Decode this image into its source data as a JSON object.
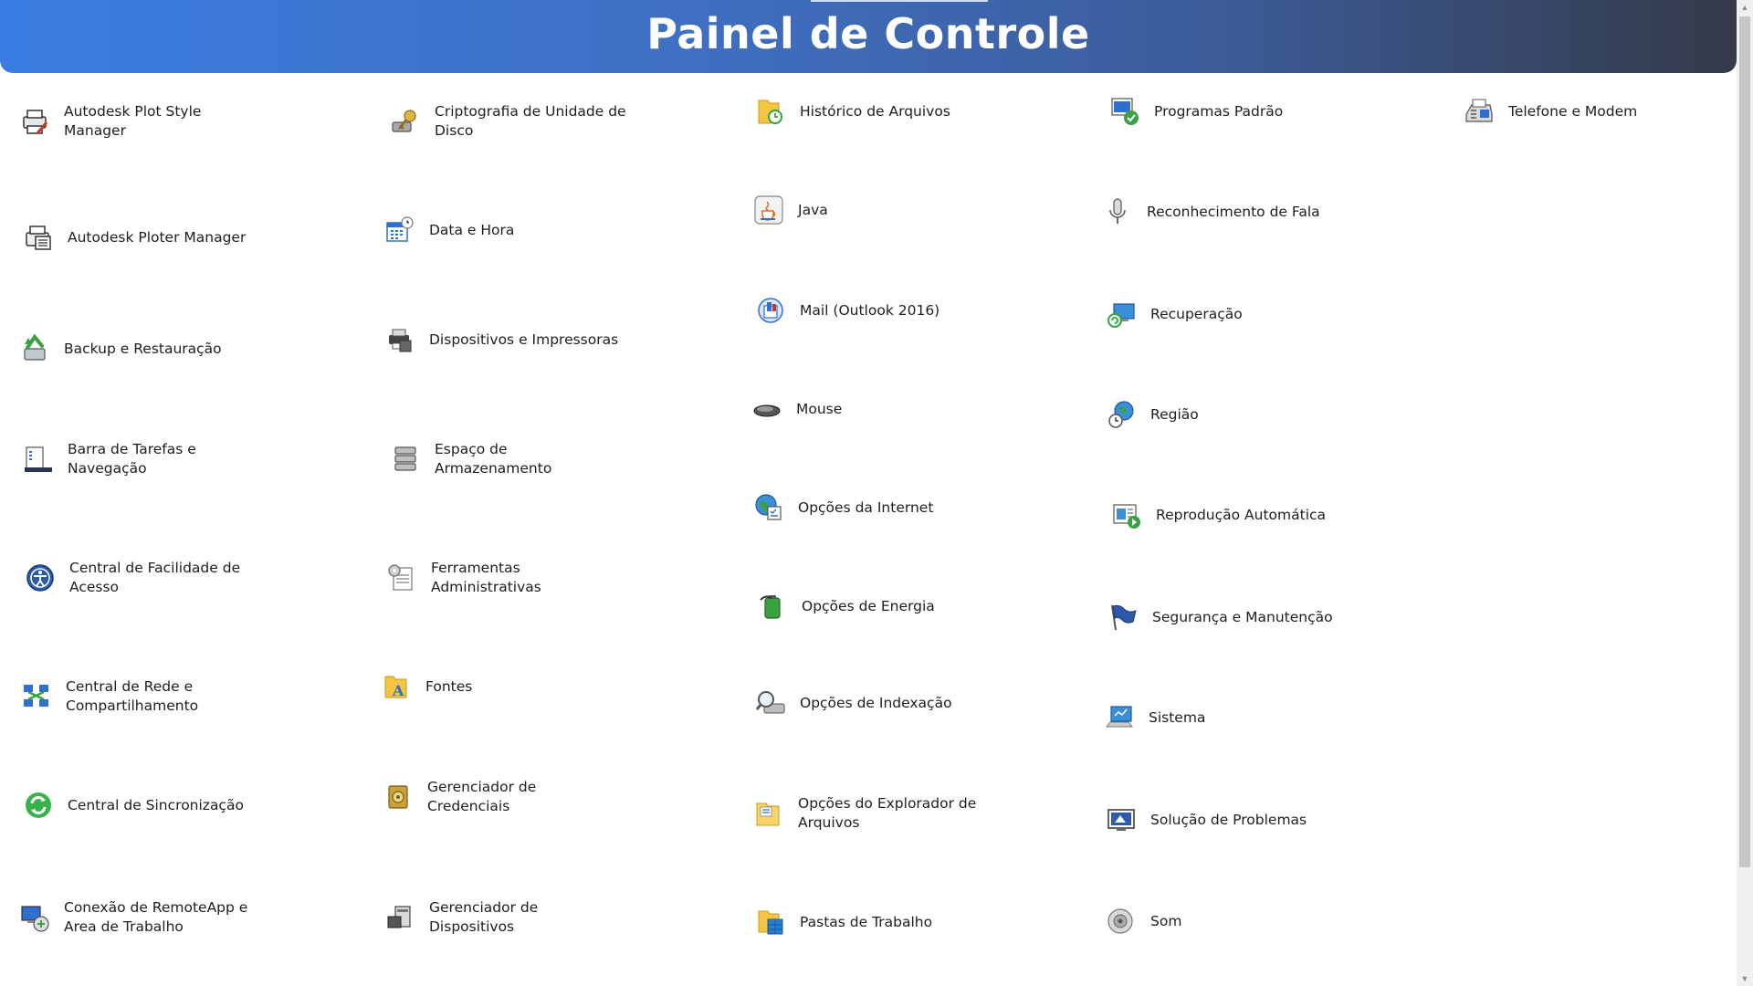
{
  "header": {
    "title": "Painel de Controle"
  },
  "items": [
    {
      "label": "Autodesk Plot Style Manager",
      "icon": "printer-pen-icon"
    },
    {
      "label": "Autodesk Ploter Manager",
      "icon": "plotter-icon"
    },
    {
      "label": "Backup e Restauração",
      "icon": "backup-restore-icon"
    },
    {
      "label": "Barra de Tarefas e Navegação",
      "icon": "taskbar-icon"
    },
    {
      "label": "Central de Facilidade de Acesso",
      "icon": "ease-of-access-icon"
    },
    {
      "label": "Central de Rede e Compartilhamento",
      "icon": "network-icon"
    },
    {
      "label": "Central de Sincronização",
      "icon": "sync-icon"
    },
    {
      "label": "Conexão de RemoteApp e Area de Trabalho",
      "icon": "remoteapp-icon"
    },
    {
      "label": "Criptografia de Unidade de Disco",
      "icon": "drive-encryption-key-icon"
    },
    {
      "label": "Data e Hora",
      "icon": "calendar-clock-icon"
    },
    {
      "label": "Dispositivos e Impressoras",
      "icon": "devices-printers-icon"
    },
    {
      "label": "Espaço de Armazenamento",
      "icon": "storage-spaces-icon"
    },
    {
      "label": "Ferramentas Administrativas",
      "icon": "admin-tools-icon"
    },
    {
      "label": "Fontes",
      "icon": "fonts-folder-icon"
    },
    {
      "label": "Gerenciador de Credenciais",
      "icon": "credential-vault-icon"
    },
    {
      "label": "Gerenciador de Dispositivos",
      "icon": "device-manager-icon"
    },
    {
      "label": "Histórico de Arquivos",
      "icon": "file-history-icon"
    },
    {
      "label": "Java",
      "icon": "java-cup-icon"
    },
    {
      "label": "Mail (Outlook 2016)",
      "icon": "mail-icon"
    },
    {
      "label": "Mouse",
      "icon": "mouse-icon"
    },
    {
      "label": "Opções da Internet",
      "icon": "internet-globe-icon"
    },
    {
      "label": "Opções de Energia",
      "icon": "power-battery-icon"
    },
    {
      "label": "Opções de Indexação",
      "icon": "indexing-magnifier-icon"
    },
    {
      "label": "Opções do Explorador de Arquivos",
      "icon": "folder-options-icon"
    },
    {
      "label": "Pastas de Trabalho",
      "icon": "work-folders-icon"
    },
    {
      "label": "Programas Padrão",
      "icon": "default-programs-icon"
    },
    {
      "label": "Reconhecimento de Fala",
      "icon": "microphone-icon"
    },
    {
      "label": "Recuperação",
      "icon": "recovery-icon"
    },
    {
      "label": "Região",
      "icon": "region-globe-clock-icon"
    },
    {
      "label": "Reprodução Automática",
      "icon": "autoplay-icon"
    },
    {
      "label": "Segurança e Manutenção",
      "icon": "flag-icon"
    },
    {
      "label": "Sistema",
      "icon": "system-computer-icon"
    },
    {
      "label": "Solução de Problemas",
      "icon": "troubleshooting-icon"
    },
    {
      "label": "Som",
      "icon": "speaker-icon"
    },
    {
      "label": "Telefone e Modem",
      "icon": "fax-modem-icon"
    }
  ]
}
